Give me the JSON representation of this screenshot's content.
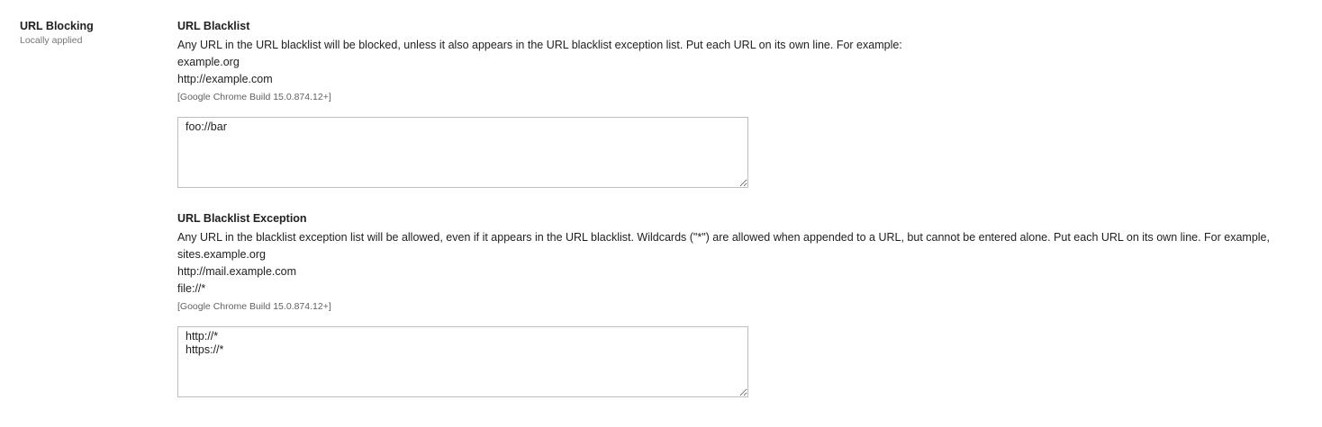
{
  "section": {
    "title": "URL Blocking",
    "subtitle": "Locally applied"
  },
  "settings": [
    {
      "title": "URL Blacklist",
      "description_lines": [
        "Any URL in the URL blacklist will be blocked, unless it also appears in the URL blacklist exception list. Put each URL on its own line. For example:",
        "example.org",
        "http://example.com"
      ],
      "build_note": "[Google Chrome Build 15.0.874.12+]",
      "value": "foo://bar"
    },
    {
      "title": "URL Blacklist Exception",
      "description_lines": [
        "Any URL in the blacklist exception list will be allowed, even if it appears in the URL blacklist. Wildcards (\"*\") are allowed when appended to a URL, but cannot be entered alone. Put each URL on its own line. For example,",
        "sites.example.org",
        "http://mail.example.com",
        "file://*"
      ],
      "build_note": "[Google Chrome Build 15.0.874.12+]",
      "value": "http://*\nhttps://*"
    }
  ]
}
